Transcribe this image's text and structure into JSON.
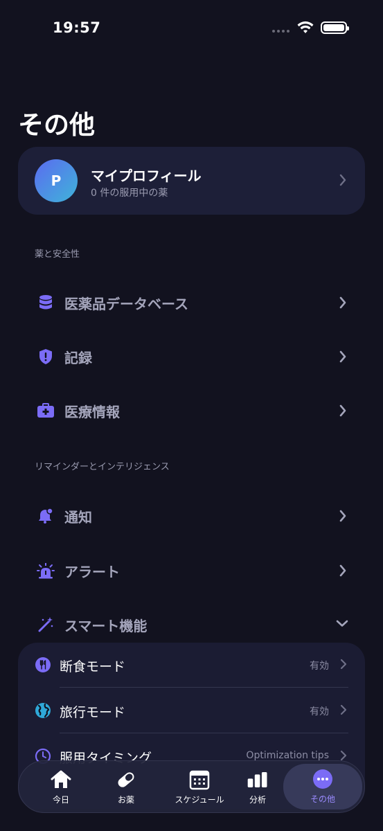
{
  "status_bar": {
    "time": "19:57"
  },
  "page_title": "その他",
  "profile": {
    "initial": "P",
    "name": "マイプロフィール",
    "subtitle": "0 件の服用中の薬"
  },
  "sections": [
    {
      "header": "薬と安全性",
      "items": [
        {
          "label": "医薬品データベース",
          "icon": "database-icon"
        },
        {
          "label": "記録",
          "icon": "shield-alert-icon"
        },
        {
          "label": "医療情報",
          "icon": "medical-kit-icon"
        }
      ]
    },
    {
      "header": "リマインダーとインテリジェンス",
      "items": [
        {
          "label": "通知",
          "icon": "bell-icon"
        },
        {
          "label": "アラート",
          "icon": "alarm-light-icon"
        },
        {
          "label": "スマート機能",
          "icon": "magic-wand-icon"
        }
      ]
    }
  ],
  "smart_features": [
    {
      "label": "断食モード",
      "value": "有効",
      "icon": "utensils-icon"
    },
    {
      "label": "旅行モード",
      "value": "有効",
      "icon": "globe-icon"
    },
    {
      "label": "服用タイミング",
      "value": "Optimization tips",
      "icon": "clock-icon"
    }
  ],
  "tabs": [
    {
      "label": "今日",
      "icon": "home-icon"
    },
    {
      "label": "お薬",
      "icon": "pill-icon"
    },
    {
      "label": "スケジュール",
      "icon": "calendar-icon"
    },
    {
      "label": "分析",
      "icon": "bar-chart-icon"
    },
    {
      "label": "その他",
      "icon": "more-icon",
      "active": true
    }
  ],
  "colors": {
    "accent": "#7b6cf6",
    "background": "#12121f",
    "card": "#1d1f38"
  }
}
